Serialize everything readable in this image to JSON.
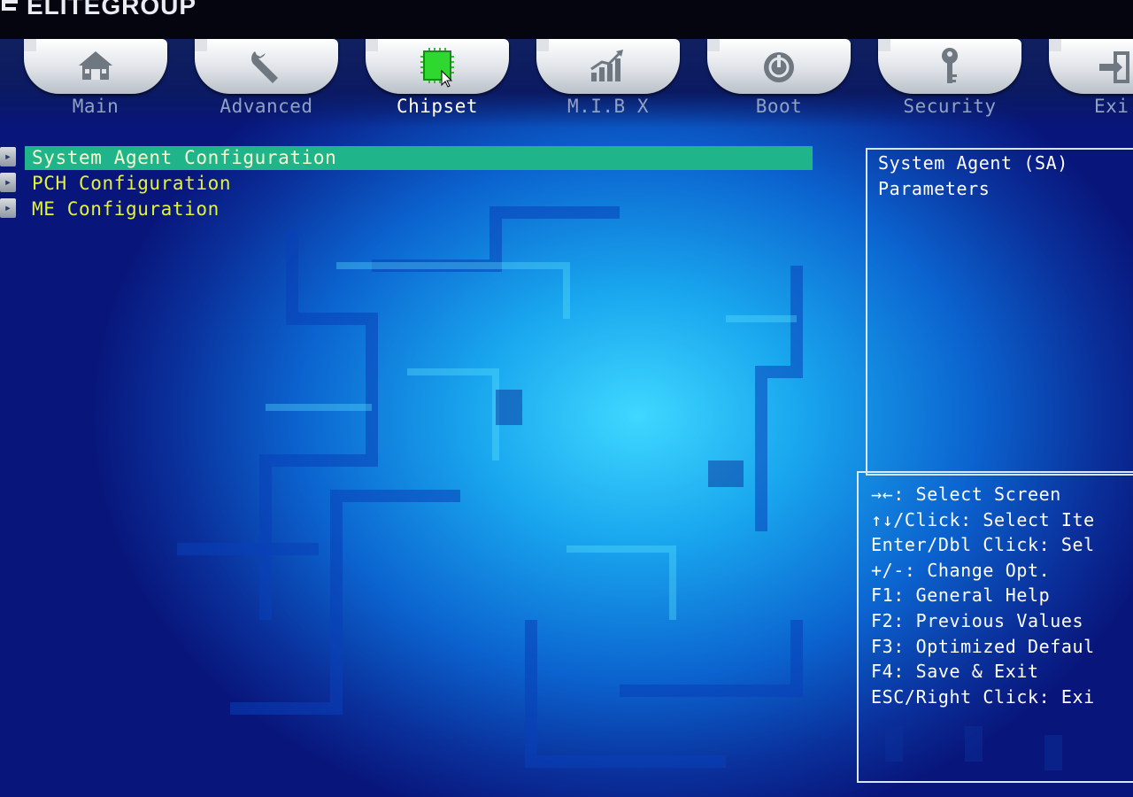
{
  "brand": {
    "name": "ELITEGROUP"
  },
  "tabs": [
    {
      "label": "Main",
      "icon": "home-icon"
    },
    {
      "label": "Advanced",
      "icon": "wrench-icon"
    },
    {
      "label": "Chipset",
      "icon": "chip-icon",
      "active": true
    },
    {
      "label": "M.I.B X",
      "icon": "chart-icon"
    },
    {
      "label": "Boot",
      "icon": "power-icon"
    },
    {
      "label": "Security",
      "icon": "key-icon"
    },
    {
      "label": "Exi",
      "icon": "exit-icon"
    }
  ],
  "menu": {
    "items": [
      {
        "label": "System Agent Configuration",
        "selected": true
      },
      {
        "label": "PCH Configuration"
      },
      {
        "label": "ME Configuration"
      }
    ]
  },
  "help": {
    "lines": [
      "System Agent (SA)",
      "Parameters"
    ]
  },
  "keys": {
    "lines": [
      "→←: Select Screen",
      "↑↓/Click: Select Ite",
      "Enter/Dbl Click: Sel",
      "+/-: Change Opt.",
      "F1: General Help",
      "F2: Previous Values",
      "F3: Optimized Defaul",
      "F4: Save & Exit",
      "ESC/Right Click: Exi"
    ]
  },
  "colors": {
    "selection": "#1fb489",
    "menu_text": "#e4f23a",
    "background_center": "#3fd8ff",
    "background_edge": "#08157a"
  }
}
